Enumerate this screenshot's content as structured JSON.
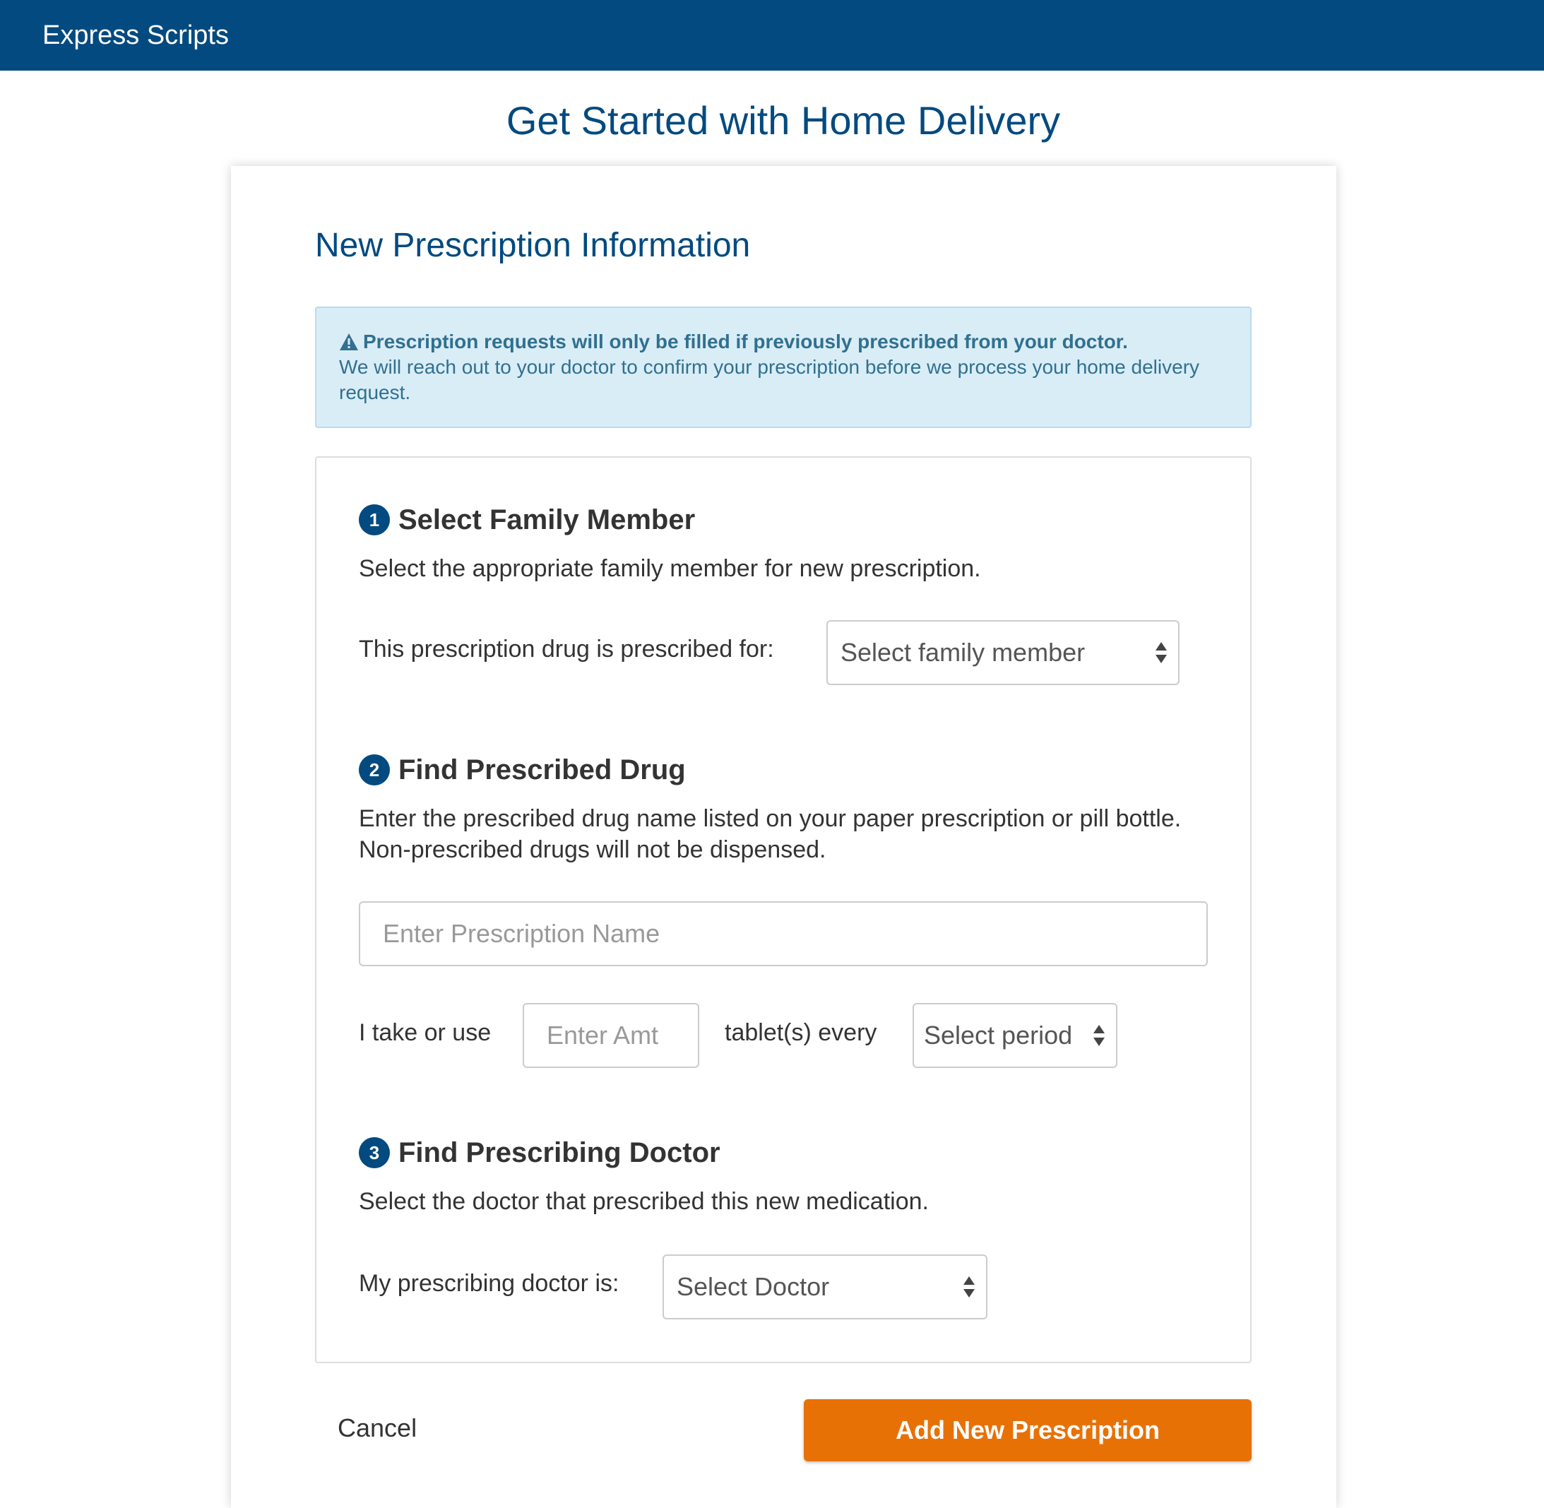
{
  "app": {
    "brand": "Express Scripts"
  },
  "page": {
    "title": "Get Started with Home Delivery"
  },
  "form": {
    "title": "New Prescription Information",
    "alert": {
      "icon": "warning-icon",
      "headline": "Prescription requests will only be filled if previously prescribed from your doctor.",
      "body": "We will reach out to your doctor to confirm your prescription before we process your home delivery request."
    },
    "step1": {
      "number": "1",
      "title": "Select Family Member",
      "description": "Select the appropriate family member for new prescription.",
      "label": "This prescription drug is prescribed for:",
      "select_value": "Select family member"
    },
    "step2": {
      "number": "2",
      "title": "Find Prescribed Drug",
      "description": "Enter the prescribed drug name listed on your paper prescription or pill bottle. Non-prescribed drugs will not be dispensed.",
      "name_placeholder": "Enter Prescription Name",
      "dose_prefix": "I take or use",
      "amount_placeholder": "Enter Amt",
      "dose_middle": "tablet(s) every",
      "period_value": "Select period"
    },
    "step3": {
      "number": "3",
      "title": "Find Prescribing Doctor",
      "description": "Select the doctor that prescribed this new medication.",
      "label": "My prescribing doctor is:",
      "select_value": "Select Doctor"
    },
    "actions": {
      "cancel": "Cancel",
      "submit": "Add New Prescription"
    }
  },
  "colors": {
    "brand_blue": "#024a7f",
    "alert_bg": "#d9edf7",
    "alert_text": "#31708f",
    "primary_button": "#e87106"
  }
}
